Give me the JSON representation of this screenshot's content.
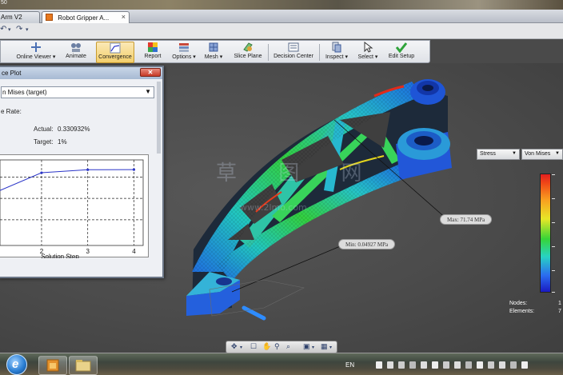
{
  "window": {
    "title_fragment": "50",
    "tabs": [
      {
        "label": "Arm V2"
      },
      {
        "label": "Robot Gripper A..."
      }
    ]
  },
  "ribbon": {
    "buttons": [
      {
        "label": "Online Viewer ▾",
        "icon": "online-viewer-icon"
      },
      {
        "label": "Animate",
        "icon": "animate-icon"
      },
      {
        "label": "Convergence",
        "icon": "convergence-icon"
      },
      {
        "label": "Report",
        "icon": "report-icon"
      },
      {
        "label": "Options ▾",
        "icon": "options-icon"
      },
      {
        "label": "Mesh ▾",
        "icon": "mesh-icon"
      },
      {
        "label": "Slice Plane",
        "icon": "slice-plane-icon"
      },
      {
        "label": "Decision Center",
        "icon": "decision-center-icon"
      },
      {
        "label": "Inspect ▾",
        "icon": "inspect-icon"
      },
      {
        "label": "Select ▾",
        "icon": "select-icon"
      },
      {
        "label": "Edit Setup",
        "icon": "edit-setup-icon"
      }
    ],
    "active": "Convergence"
  },
  "convergence_dialog": {
    "title": "ce Plot",
    "selected_result": "n Mises (target)",
    "rate_label": "e Rate:",
    "actual_label": "Actual:",
    "actual_value": "0.330932%",
    "target_label": "Target:",
    "target_value": "1%"
  },
  "chart_data": {
    "type": "line",
    "x": [
      1,
      2,
      3,
      4
    ],
    "series": [
      {
        "values": [
          0.62,
          0.85,
          0.885,
          0.887
        ]
      }
    ],
    "xticks": [
      "2",
      "3",
      "4"
    ],
    "xlabel": "Solution Step",
    "ylabel": "",
    "xlim": [
      1.1,
      4.2
    ],
    "ylim": [
      0,
      1
    ],
    "grid": true,
    "color": "#2b35c8"
  },
  "results_panel": {
    "component": "Stress",
    "type": "Von Mises",
    "nodes_label": "Nodes:",
    "nodes_value": "1",
    "elements_label": "Elements:",
    "elements_value": "7"
  },
  "callouts": {
    "max": "Max: 71.74 MPa",
    "min": "Min: 0.04927 MPa"
  },
  "watermark": {
    "main": "草 图 网",
    "url": "www.2lmo.com"
  },
  "taskbar": {
    "language": "EN"
  },
  "colors": {
    "ribbon_active": "#f3cf6c",
    "dialog_title": "#a7bad3",
    "series_line": "#2b35c8"
  }
}
